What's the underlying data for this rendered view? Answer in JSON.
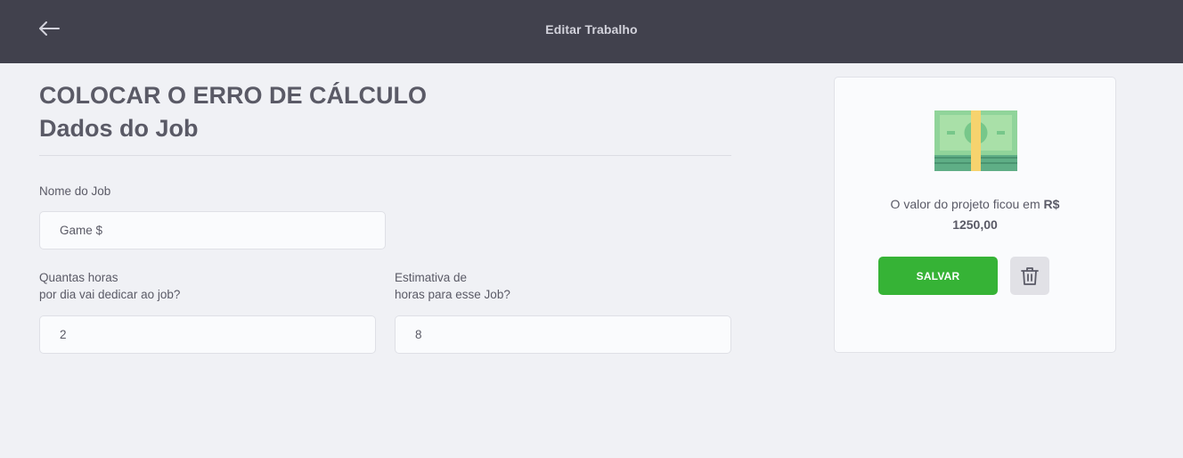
{
  "header": {
    "title": "Editar Trabalho",
    "back_icon": "arrow-left-icon"
  },
  "main": {
    "heading_line1": "COLOCAR O ERRO DE CÁLCULO",
    "heading_line2": "Dados do Job",
    "fields": {
      "name": {
        "label": "Nome do Job",
        "value": "Game $"
      },
      "daily_hours": {
        "label_line1": "Quantas horas",
        "label_line2": "por dia vai dedicar ao job?",
        "value": "2"
      },
      "total_hours": {
        "label_line1": "Estimativa de",
        "label_line2": "horas para esse Job?",
        "value": "8"
      }
    }
  },
  "card": {
    "icon": "money-icon",
    "text_prefix": "O valor do projeto ficou em",
    "currency": "R$",
    "value": "1250,00",
    "save_label": "SALVAR",
    "delete_icon": "trash-icon"
  },
  "colors": {
    "header_bg": "#41414d",
    "page_bg": "#f0f1f5",
    "accent_green": "#36b336",
    "text": "#5a5a66"
  }
}
